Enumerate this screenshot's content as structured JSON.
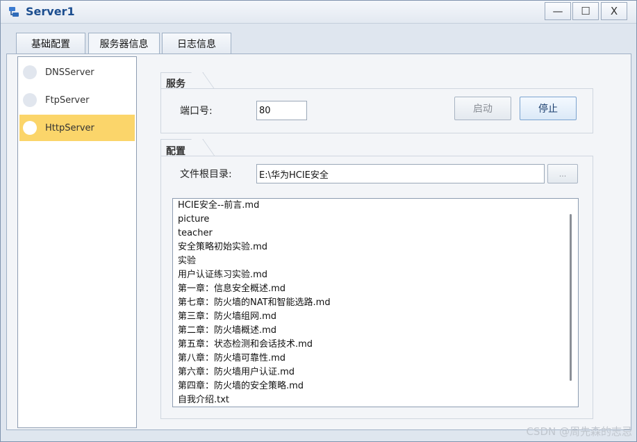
{
  "window": {
    "title": "Server1",
    "controls": {
      "minimize": "—",
      "maximize": "☐",
      "close": "X"
    }
  },
  "tabs": [
    {
      "label": "基础配置",
      "active": false
    },
    {
      "label": "服务器信息",
      "active": true
    },
    {
      "label": "日志信息",
      "active": false
    }
  ],
  "sidebar": {
    "items": [
      {
        "label": "DNSServer",
        "selected": false
      },
      {
        "label": "FtpServer",
        "selected": false
      },
      {
        "label": "HttpServer",
        "selected": true
      }
    ]
  },
  "service": {
    "group_title": "服务",
    "port_label": "端口号:",
    "port_value": "80",
    "start_button": "启动",
    "stop_button": "停止"
  },
  "config": {
    "group_title": "配置",
    "root_label": "文件根目录:",
    "root_value": "E:\\华为HCIE安全",
    "browse_button": "...",
    "files": [
      "HCIE安全--前言.md",
      "picture",
      "teacher",
      "安全策略初始实验.md",
      "实验",
      "用户认证练习实验.md",
      "第一章：信息安全概述.md",
      "第七章：防火墙的NAT和智能选路.md",
      "第三章：防火墙组网.md",
      "第二章：防火墙概述.md",
      "第五章：状态检测和会话技术.md",
      "第八章：防火墙可靠性.md",
      "第六章：防火墙用户认证.md",
      "第四章：防火墙的安全策略.md",
      "自我介绍.txt"
    ]
  },
  "watermark": "CSDN @周先森的志忌",
  "colors": {
    "title": "#1c4e8f",
    "selected": "#fbd56a",
    "window_bg": "#dfe6ef"
  }
}
